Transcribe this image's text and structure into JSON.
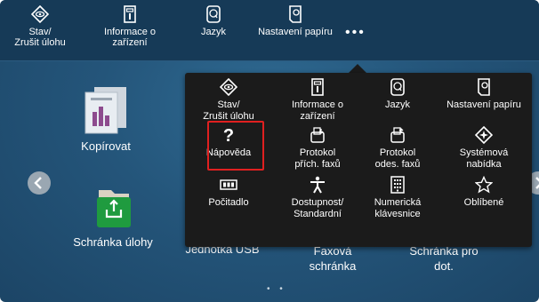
{
  "topbar": {
    "items": [
      {
        "label": "Stav/\nZrušit úlohu",
        "icon": "job-status-icon"
      },
      {
        "label": "Informace o\nzařízení",
        "icon": "device-info-icon"
      },
      {
        "label": "Jazyk",
        "icon": "language-icon"
      },
      {
        "label": "Nastavení papíru",
        "icon": "paper-settings-icon"
      }
    ],
    "more": "•••"
  },
  "home": {
    "tiles": [
      {
        "label": "Kopírovat",
        "icon": "copy-icon"
      },
      {
        "label": "Schránka úlohy",
        "icon": "job-box-icon"
      },
      {
        "label": "Jednotka USB",
        "icon": "usb-drive-icon"
      },
      {
        "label": "Faxová\nschránka",
        "icon": "fax-box-icon"
      },
      {
        "label": "Schránka pro\ndot.",
        "icon": "polling-box-icon"
      }
    ],
    "page_dots": "• •"
  },
  "popup": {
    "items": [
      {
        "label": "Stav/\nZrušit úlohu",
        "icon": "job-status-icon"
      },
      {
        "label": "Informace o\nzařízení",
        "icon": "device-info-icon"
      },
      {
        "label": "Jazyk",
        "icon": "language-icon"
      },
      {
        "label": "Nastavení papíru",
        "icon": "paper-settings-icon"
      },
      {
        "label": "Nápověda",
        "icon": "help-icon"
      },
      {
        "label": "Protokol\npřích. faxů",
        "icon": "fax-rx-log-icon"
      },
      {
        "label": "Protokol\nodes. faxů",
        "icon": "fax-tx-log-icon"
      },
      {
        "label": "Systémová\nnabídka",
        "icon": "system-menu-icon"
      },
      {
        "label": "Počitadlo",
        "icon": "counter-icon"
      },
      {
        "label": "Dostupnost/\nStandardní",
        "icon": "accessibility-icon"
      },
      {
        "label": "Numerická\nklávesnice",
        "icon": "numeric-keypad-icon"
      },
      {
        "label": "Oblíbené",
        "icon": "favorites-icon"
      }
    ]
  },
  "colors": {
    "topbar": "#163a57",
    "popup": "#1b1b1b",
    "highlight": "#e02020",
    "green_tile": "#1f9b3f"
  }
}
